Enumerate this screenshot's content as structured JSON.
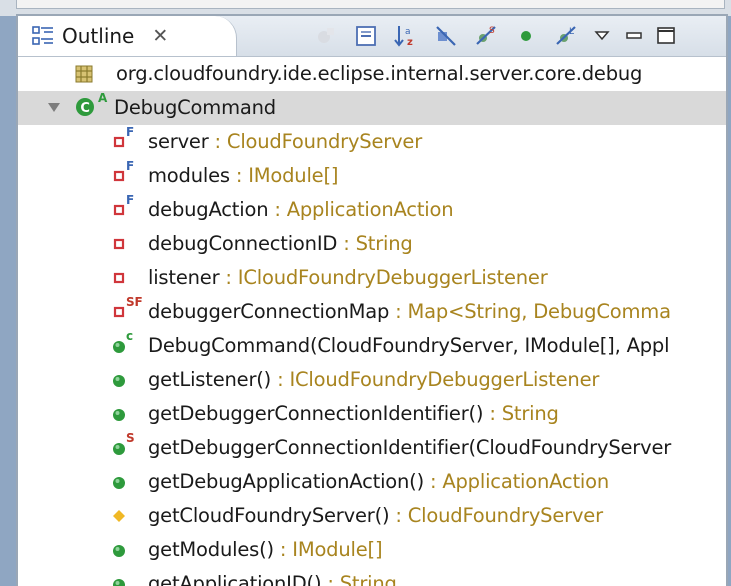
{
  "tab": {
    "title": "Outline",
    "close_glyph": "✕"
  },
  "toolbar": {
    "buttons": [
      "hide-non-public-icon",
      "collapse-all-icon",
      "sort-icon",
      "hide-fields-icon",
      "hide-static-icon",
      "public-members-icon",
      "hide-local-types-icon",
      "view-menu-icon",
      "minimize-icon",
      "maximize-icon"
    ]
  },
  "colors": {
    "type_text": "#a8841f",
    "private_field": "#d0363b",
    "public_method": "#2e9a3c",
    "protected_method": "#f0b825",
    "selection": "#d9d9d9"
  },
  "tree": {
    "package": {
      "name": "org.cloudfoundry.ide.eclipse.internal.server.core.debug"
    },
    "class": {
      "name": "DebugCommand",
      "overlay": "A"
    },
    "members": [
      {
        "name": "server",
        "type": " : CloudFoundryServer",
        "icon": "private-field-icon",
        "overlay": "F"
      },
      {
        "name": "modules",
        "type": " : IModule[]",
        "icon": "private-field-icon",
        "overlay": "F"
      },
      {
        "name": "debugAction",
        "type": " : ApplicationAction",
        "icon": "private-field-icon",
        "overlay": "F"
      },
      {
        "name": "debugConnectionID",
        "type": " : String",
        "icon": "private-field-icon",
        "overlay": ""
      },
      {
        "name": "listener",
        "type": " : ICloudFoundryDebuggerListener",
        "icon": "private-field-icon",
        "overlay": ""
      },
      {
        "name": "debuggerConnectionMap",
        "type": " : Map<String, DebugComma",
        "icon": "private-field-icon",
        "overlay": "SF"
      },
      {
        "name": "DebugCommand(CloudFoundryServer, IModule[], Appl",
        "type": "",
        "icon": "public-method-icon",
        "overlay": "c"
      },
      {
        "name": "getListener()",
        "type": " : ICloudFoundryDebuggerListener",
        "icon": "public-method-icon",
        "overlay": ""
      },
      {
        "name": "getDebuggerConnectionIdentifier()",
        "type": " : String",
        "icon": "public-method-icon",
        "overlay": ""
      },
      {
        "name": "getDebuggerConnectionIdentifier(CloudFoundryServer",
        "type": "",
        "icon": "public-method-icon",
        "overlay": "S"
      },
      {
        "name": "getDebugApplicationAction()",
        "type": " : ApplicationAction",
        "icon": "public-method-icon",
        "overlay": ""
      },
      {
        "name": "getCloudFoundryServer()",
        "type": " : CloudFoundryServer",
        "icon": "protected-method-icon",
        "overlay": ""
      },
      {
        "name": "getModules()",
        "type": " : IModule[]",
        "icon": "public-method-icon",
        "overlay": ""
      },
      {
        "name": "getApplicationID()",
        "type": " : String",
        "icon": "public-method-icon",
        "overlay": ""
      }
    ]
  }
}
